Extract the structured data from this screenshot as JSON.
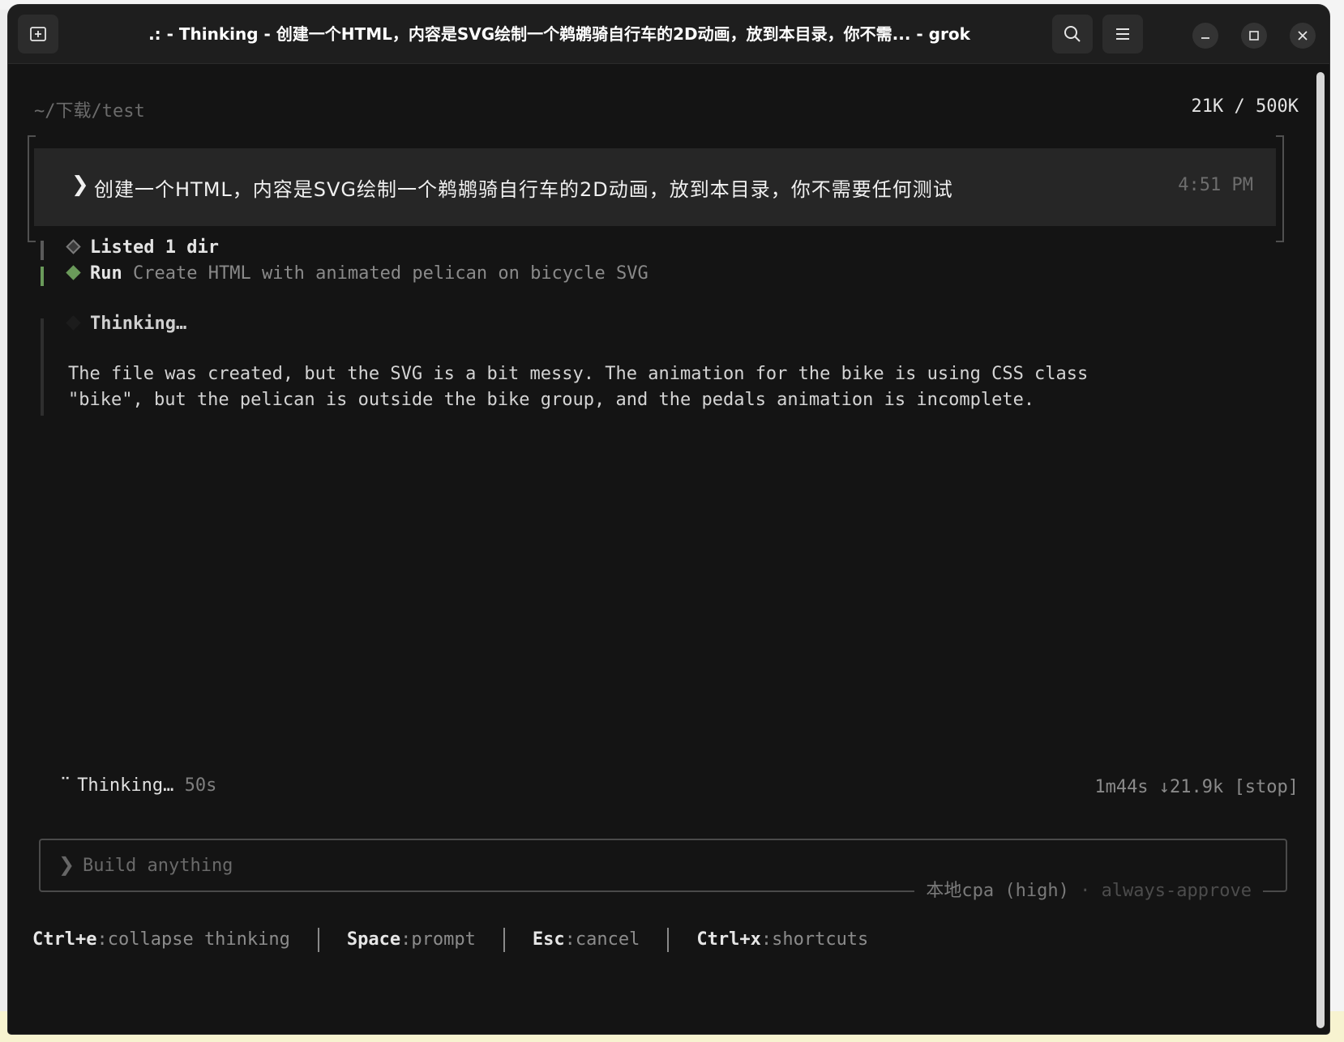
{
  "window": {
    "title": ".: - Thinking - 创建一个HTML，内容是SVG绘制一个鹈鹕骑自行车的2D动画，放到本目录，你不需... - grok"
  },
  "header": {
    "cwd": "~/下载/test",
    "token_usage": "21K / 500K"
  },
  "prompt": {
    "text": "创建一个HTML，内容是SVG绘制一个鹈鹕骑自行车的2D动画，放到本目录，你不需要任何测试",
    "time": "4:51 PM"
  },
  "log": {
    "listed": "Listed 1 dir",
    "run_label": "Run",
    "run_desc": "Create HTML with animated pelican on bicycle SVG",
    "thinking_label": "Thinking…",
    "message_line1": "The file was created, but the SVG is a bit messy. The animation for the bike is using CSS class",
    "message_line2": "\"bike\", but the pelican is outside the bike group, and the pedals animation is incomplete."
  },
  "status": {
    "thinking": "Thinking…",
    "elapsed": "50s",
    "run_stats": "1m44s ↓21.9k [stop]"
  },
  "input": {
    "placeholder": "Build anything",
    "model": "本地cpa (high)",
    "separator": "·",
    "mode": "always-approve"
  },
  "hints": [
    {
      "key": "Ctrl+e",
      "action": "collapse thinking"
    },
    {
      "key": "Space",
      "action": "prompt"
    },
    {
      "key": "Esc",
      "action": "cancel"
    },
    {
      "key": "Ctrl+x",
      "action": "shortcuts"
    }
  ],
  "colors": {
    "terminal_bg": "#141414",
    "accent_green": "#6a9a5a"
  }
}
